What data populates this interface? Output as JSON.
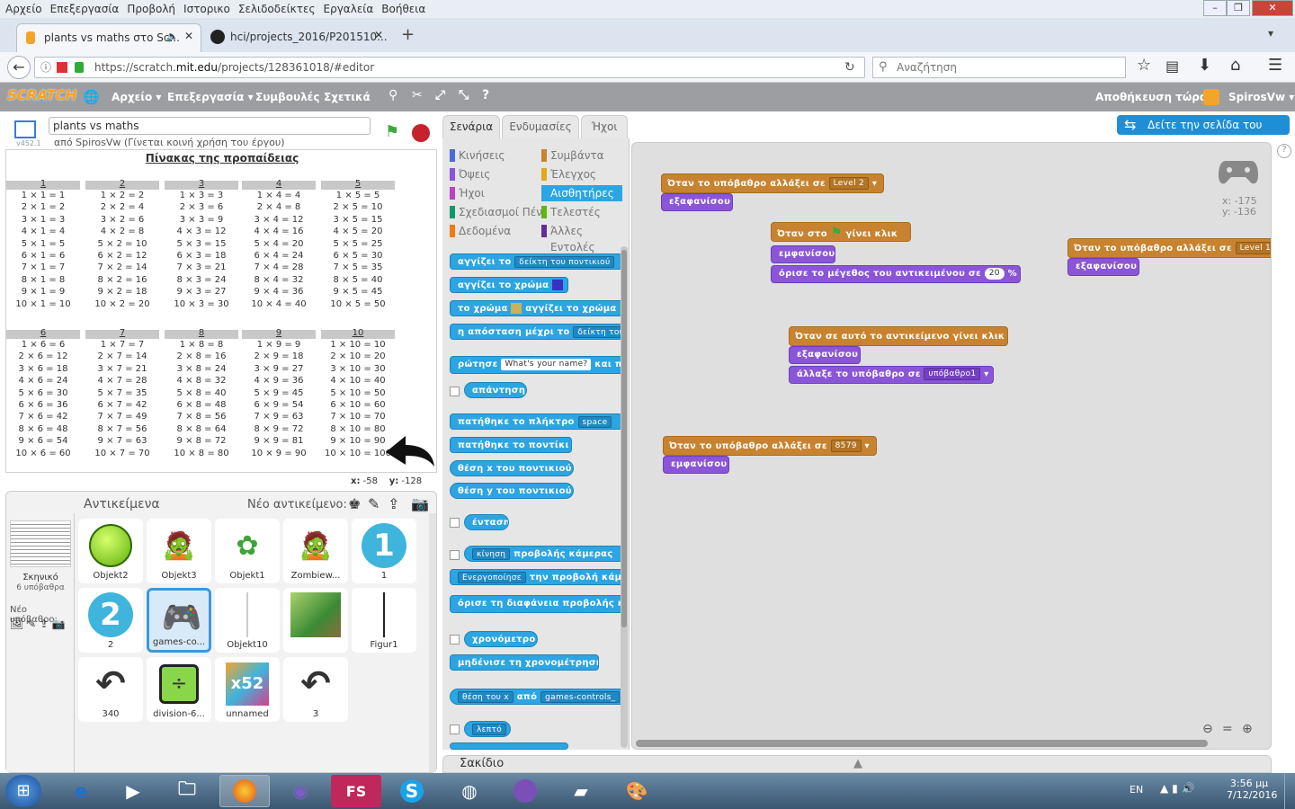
{
  "menu": [
    "Αρχείο",
    "Επεξεργασία",
    "Προβολή",
    "Ιστορικο",
    "Σελιδοδείκτες",
    "Εργαλεία",
    "Βοήθεια"
  ],
  "tabs": [
    {
      "label": "plants vs maths στο Sc..."
    },
    {
      "label": "hci/projects_2016/P201510..."
    }
  ],
  "url": {
    "prefix": "https://scratch.",
    "host": "mit.edu",
    "rest": "/projects/128361018/#editor"
  },
  "search_placeholder": "Αναζήτηση",
  "scratch": {
    "logo": "SCRATCH",
    "menu": [
      "Αρχείο ▾",
      "Επεξεργασία ▾",
      "Συμβουλές",
      "Σχετικά"
    ],
    "save": "Αποθήκευση τώρα",
    "user": "SpirosVw ▾",
    "see_page": "Δείτε την σελίδα του έργου",
    "version": "v452.1"
  },
  "project": {
    "title": "plants vs maths",
    "by": "από SpirosVw (Γίνεται κοινή χρήση του έργου)"
  },
  "stage": {
    "heading": "Πίνακας της προπαίδειας",
    "coords": {
      "x_label": "x:",
      "x": "-58",
      "y_label": "y:",
      "y": "-128"
    }
  },
  "tables": [
    {
      "h": "1",
      "rows": [
        "1 × 1 = 1",
        "2 × 1 = 2",
        "3 × 1 = 3",
        "4 × 1 = 4",
        "5 × 1 = 5",
        "6 × 1 = 6",
        "7 × 1 = 7",
        "8 × 1 = 8",
        "9 × 1 = 9",
        "10 × 1 = 10"
      ]
    },
    {
      "h": "2",
      "rows": [
        "1 × 2 = 2",
        "2 × 2 = 4",
        "3 × 2 = 6",
        "4 × 2 = 8",
        "5 × 2 = 10",
        "6 × 2 = 12",
        "7 × 2 = 14",
        "8 × 2 = 16",
        "9 × 2 = 18",
        "10 × 2 = 20"
      ]
    },
    {
      "h": "3",
      "rows": [
        "1 × 3 = 3",
        "2 × 3 = 6",
        "3 × 3 = 9",
        "4 × 3 = 12",
        "5 × 3 = 15",
        "6 × 3 = 18",
        "7 × 3 = 21",
        "8 × 3 = 24",
        "9 × 3 = 27",
        "10 × 3 = 30"
      ]
    },
    {
      "h": "4",
      "rows": [
        "1 × 4 = 4",
        "2 × 4 = 8",
        "3 × 4 = 12",
        "4 × 4 = 16",
        "5 × 4 = 20",
        "6 × 4 = 24",
        "7 × 4 = 28",
        "8 × 4 = 32",
        "9 × 4 = 36",
        "10 × 4 = 40"
      ]
    },
    {
      "h": "5",
      "rows": [
        "1 × 5 = 5",
        "2 × 5 = 10",
        "3 × 5 = 15",
        "4 × 5 = 20",
        "5 × 5 = 25",
        "6 × 5 = 30",
        "7 × 5 = 35",
        "8 × 5 = 40",
        "9 × 5 = 45",
        "10 × 5 = 50"
      ]
    },
    {
      "h": "6",
      "rows": [
        "1 × 6 = 6",
        "2 × 6 = 12",
        "3 × 6 = 18",
        "4 × 6 = 24",
        "5 × 6 = 30",
        "6 × 6 = 36",
        "7 × 6 = 42",
        "8 × 6 = 48",
        "9 × 6 = 54",
        "10 × 6 = 60"
      ]
    },
    {
      "h": "7",
      "rows": [
        "1 × 7 = 7",
        "2 × 7 = 14",
        "3 × 7 = 21",
        "4 × 7 = 28",
        "5 × 7 = 35",
        "6 × 7 = 42",
        "7 × 7 = 49",
        "8 × 7 = 56",
        "9 × 7 = 63",
        "10 × 7 = 70"
      ]
    },
    {
      "h": "8",
      "rows": [
        "1 × 8 = 8",
        "2 × 8 = 16",
        "3 × 8 = 24",
        "4 × 8 = 32",
        "5 × 8 = 40",
        "6 × 8 = 48",
        "7 × 8 = 56",
        "8 × 8 = 64",
        "9 × 8 = 72",
        "10 × 8 = 80"
      ]
    },
    {
      "h": "9",
      "rows": [
        "1 × 9 = 9",
        "2 × 9 = 18",
        "3 × 9 = 27",
        "4 × 9 = 36",
        "5 × 9 = 45",
        "6 × 9 = 54",
        "7 × 9 = 63",
        "8 × 9 = 72",
        "9 × 9 = 81",
        "10 × 9 = 90"
      ]
    },
    {
      "h": "10",
      "rows": [
        "1 × 10 = 10",
        "2 × 10 = 20",
        "3 × 10 = 30",
        "4 × 10 = 40",
        "5 × 10 = 50",
        "6 × 10 = 60",
        "7 × 10 = 70",
        "8 × 10 = 80",
        "9 × 10 = 90",
        "10 × 10 = 100"
      ]
    }
  ],
  "sprites_panel": {
    "title": "Αντικείμενα",
    "new": "Νέο αντικείμενο:",
    "backdrop_label": "Σκηνικό",
    "backdrop_count": "6 υπόβαθρα",
    "new_backdrop": "Νέο υπόβαθρο:"
  },
  "sprites": [
    "Objekt2",
    "Objekt3",
    "Objekt1",
    "Zombiew...",
    "1",
    "2",
    "games-co...",
    "Objekt10",
    "",
    "Figur1",
    "340",
    "division-6...",
    "unnamed",
    "3"
  ],
  "editor_tabs": [
    "Σενάρια",
    "Ενδυμασίες",
    "Ήχοι"
  ],
  "categories": [
    "Κινήσεις",
    "Όψεις",
    "Ήχοι",
    "Σχεδιασμοί Πένας",
    "Δεδομένα",
    "Συμβάντα",
    "Έλεγχος",
    "Αισθητήρες",
    "Τελεστές",
    "Άλλες Εντολές"
  ],
  "palette": {
    "touching": "αγγίζει το",
    "mouse_pointer": "δείκτη του ποντικιού",
    "touching_color": "αγγίζει το χρώμα",
    "color": "το χρώμα",
    "touching_color2": "αγγίζει το χρώμα",
    "distance": "η απόσταση μέχρι το",
    "distance_dd": "δείκτη του π",
    "ask": "ρώτησε",
    "ask_input": "What's your name?",
    "ask_wait": "και πε",
    "answer": "απάντηση",
    "key_pressed": "πατήθηκε το πλήκτρο",
    "key": "space",
    "mouse_down": "πατήθηκε το ποντίκι",
    "mouse_x": "θέση x του ποντικιού",
    "mouse_y": "θέση y του ποντικιού",
    "loudness": "ένταση",
    "video_motion": "κίνηση",
    "video_on": "προβολής κάμερας",
    "turn_video": "Ενεργοποίησε",
    "video_state": "την προβολή κάμ",
    "transparency": "όρισε τη διαφάνεια προβολής κα",
    "timer": "χρονόμετρο",
    "reset_timer": "μηδένισε τη χρονομέτρηση",
    "of_prop": "θέση του x",
    "of": "από",
    "of_obj": "games-controls_",
    "current": "λεπτό"
  },
  "scripts": {
    "s1": {
      "hat": "Όταν το υπόβαθρο αλλάξει σε",
      "val": "Level 2",
      "b1": "εξαφανίσου"
    },
    "s2": {
      "hat_a": "Όταν στο",
      "hat_b": "γίνει κλικ",
      "b1": "εμφανίσου",
      "b2": "όρισε το μέγεθος του αντικειμένου σε",
      "b2v": "20",
      "b2u": "%"
    },
    "s3": {
      "hat": "Όταν το υπόβαθρο αλλάξει σε",
      "val": "Level 1",
      "b1": "εξαφανίσου"
    },
    "s4": {
      "hat": "Όταν σε αυτό το αντικείμενο γίνει κλικ",
      "b1": "εξαφανίσου",
      "b2": "άλλαξε το υπόβαθρο σε",
      "b2v": "υπόβαθρο1"
    },
    "s5": {
      "hat": "Όταν το υπόβαθρο αλλάξει σε",
      "val": "8579",
      "b1": "εμφανίσου"
    },
    "sprite_xy": {
      "x": "x: -175",
      "y": "y: -136"
    }
  },
  "backpack": "Σακίδιο",
  "taskbar": {
    "lang": "EN",
    "time": "3:56 μμ",
    "date": "7/12/2016"
  },
  "colors": {
    "events": "#c88330",
    "looks": "#8a55d7",
    "sensing": "#2ca5e2",
    "scratch_blue": "#1e8fd6"
  }
}
